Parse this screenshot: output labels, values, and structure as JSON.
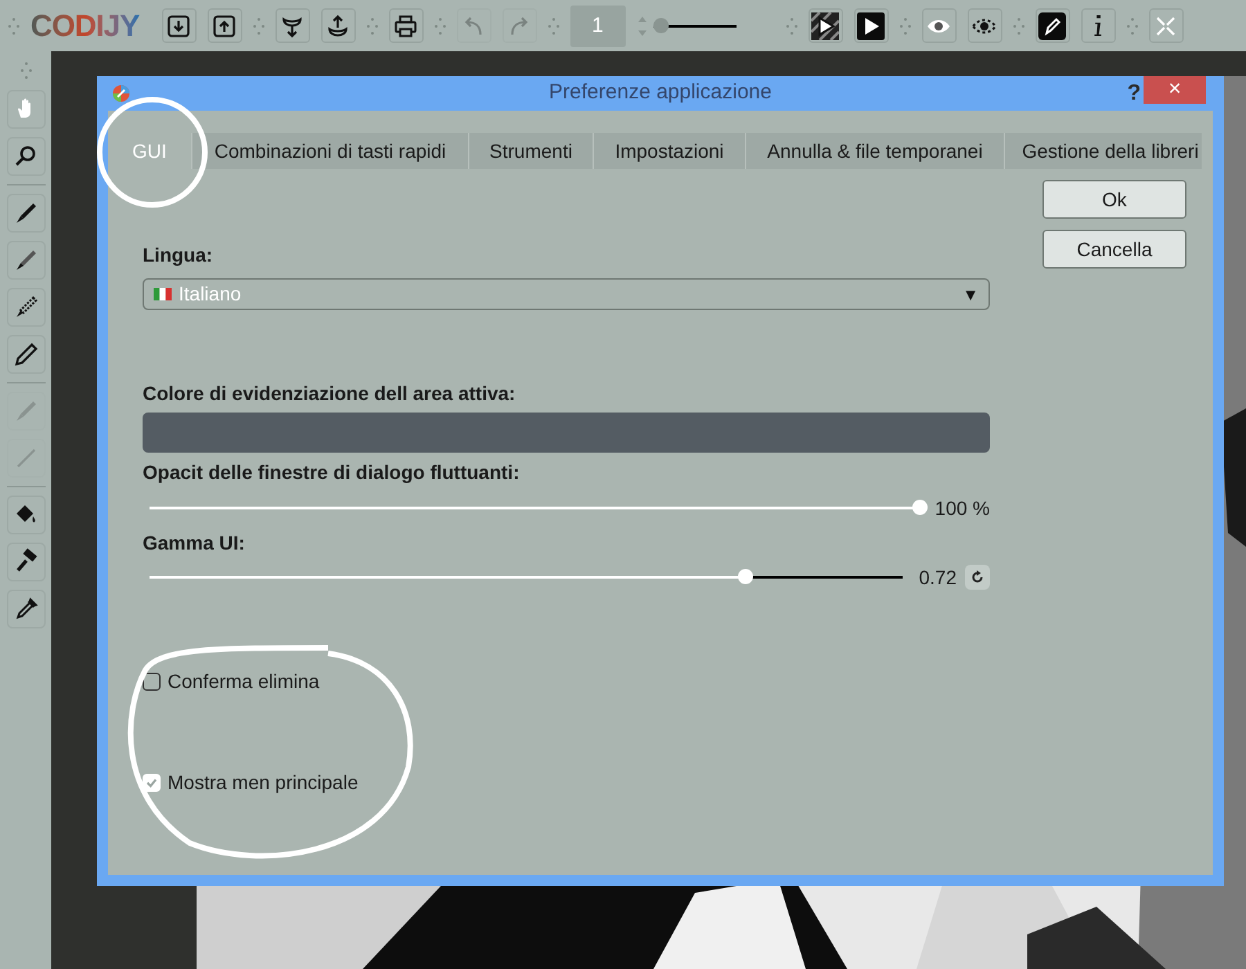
{
  "toolbar": {
    "logo": "CODIJY",
    "buttons": [
      {
        "disabled": false
      },
      {
        "disabled": false
      },
      {
        "disabled": false
      },
      {
        "disabled": false
      },
      {
        "disabled": false
      },
      {
        "disabled": true
      },
      {
        "disabled": true
      }
    ],
    "frame_field": {
      "value": "1"
    },
    "zoom_slider": {
      "level": 0
    },
    "buttons_right": [
      {
        "disabled": false
      },
      {
        "disabled": false
      },
      {
        "disabled": false
      },
      {
        "disabled": false
      },
      {
        "disabled": false
      },
      {
        "disabled": false
      },
      {
        "disabled": false
      }
    ]
  },
  "tools": [
    {
      "disabled": false
    },
    {
      "disabled": false
    },
    {
      "disabled": false
    },
    {
      "disabled": false
    },
    {
      "disabled": false
    },
    {
      "disabled": false
    },
    {
      "disabled": true
    },
    {
      "disabled": true
    },
    {
      "disabled": false
    },
    {
      "disabled": false
    },
    {
      "disabled": false
    }
  ],
  "dialog": {
    "title": "Preferenze applicazione",
    "help": "?",
    "close": "×",
    "tabs": [
      {
        "label": "GUI",
        "selected": true
      },
      {
        "label": "Combinazioni di tasti rapidi",
        "selected": false
      },
      {
        "label": "Strumenti",
        "selected": false
      },
      {
        "label": "Impostazioni",
        "selected": false
      },
      {
        "label": "Annulla & file temporanei",
        "selected": false
      },
      {
        "label": "Gestione della libreri",
        "selected": false
      }
    ],
    "buttons": [
      "Ok",
      "Cancella"
    ],
    "language": {
      "label": "Lingua:",
      "value": "Italiano",
      "arrow": "▼"
    },
    "highlight": {
      "label": "Colore di evidenziazione dell area attiva:",
      "color": "#545c63"
    },
    "opacity": {
      "label": "Opacit delle finestre di dialogo fluttuanti:",
      "level": 1,
      "reading": "100 %"
    },
    "gamma": {
      "label": "Gamma UI:",
      "level": 0.79,
      "reading": "0.72"
    },
    "options": [
      {
        "label": "Conferma elimina",
        "checked": false
      },
      {
        "label": "Mostra men principale",
        "checked": true
      }
    ]
  }
}
